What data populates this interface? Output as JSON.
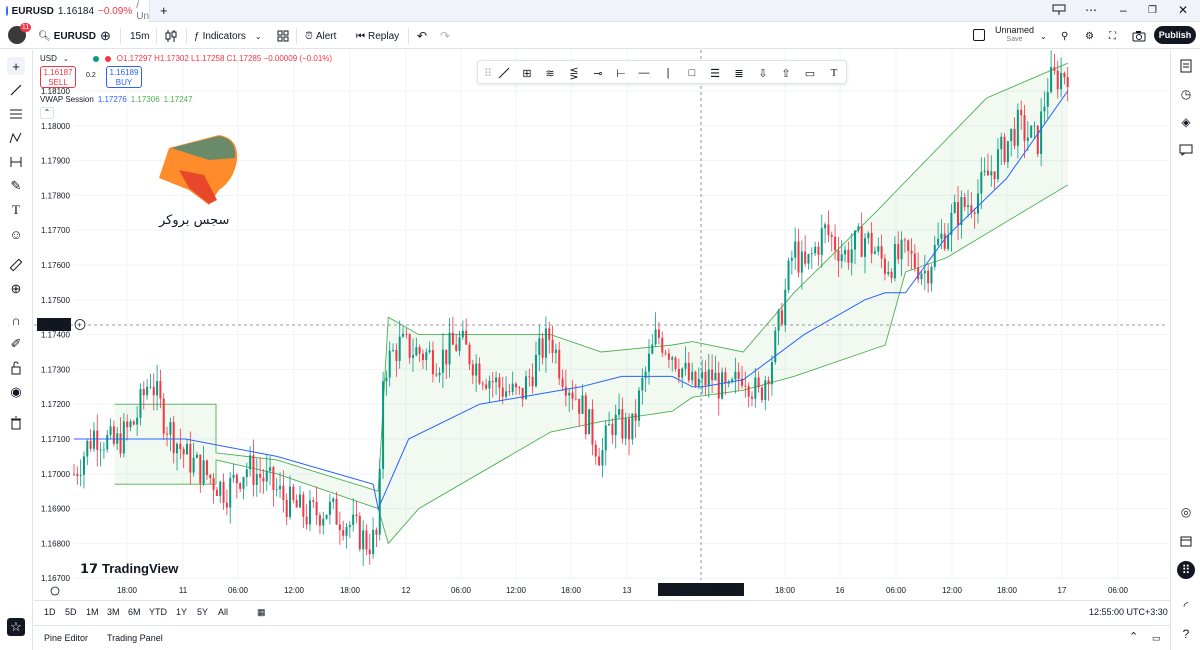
{
  "browser_tab": {
    "symbol": "EURUSD",
    "price": "1.16184",
    "change": "−0.09%",
    "suffix": "/ Un"
  },
  "header": {
    "symbol": "EURUSD",
    "interval": "15m",
    "indicators_label": "Indicators",
    "alert_label": "Alert",
    "replay_label": "Replay",
    "layout_name": "Unnamed",
    "layout_status": "Save",
    "publish_label": "Publish",
    "notif_count": "11"
  },
  "legend": {
    "currency": "USD",
    "ohlc": "O1.17297 H1.17302 L1.17258 C1.17285 −0.00009 (−0.01%)",
    "sell_price": "1.16187",
    "sell_label": "SELL",
    "spread": "0.2",
    "buy_price": "1.16189",
    "buy_label": "BUY",
    "vwap_label": "VWAP Session",
    "vwap_v1": "1.17276",
    "vwap_v2": "1.17306",
    "vwap_v3": "1.17247"
  },
  "watermark": {
    "text": "سجس بروكر",
    "tv_text": "TradingView"
  },
  "crosshair": {
    "price_label": "1.17427",
    "time_label": "Mon 15 Sep '25   09:00"
  },
  "range_buttons": [
    "1D",
    "5D",
    "1M",
    "3M",
    "6M",
    "YTD",
    "1Y",
    "5Y",
    "All"
  ],
  "clock": "12:55:00 UTC+3:30",
  "footer": {
    "pine_editor": "Pine Editor",
    "trading_panel": "Trading Panel"
  },
  "colors": {
    "up": "#089981",
    "down": "#f23645",
    "vwap": "#2962ff",
    "band": "#4caf50",
    "band_fill": "rgba(76,175,80,0.08)"
  },
  "chart_data": {
    "type": "candlestick",
    "symbol": "EURUSD",
    "y_ticks": [
      "1.18100",
      "1.18000",
      "1.17900",
      "1.17800",
      "1.17700",
      "1.17600",
      "1.17500",
      "1.17400",
      "1.17300",
      "1.17200",
      "1.17100",
      "1.17000",
      "1.16900",
      "1.16800",
      "1.16700"
    ],
    "x_ticks": [
      "18:00",
      "11",
      "06:00",
      "12:00",
      "18:00",
      "12",
      "06:00",
      "12:00",
      "18:00",
      "13",
      "18:00",
      "16",
      "06:00",
      "12:00",
      "18:00",
      "17",
      "06:00"
    ],
    "ylim": [
      1.1667,
      1.1815
    ],
    "price_path": [
      [
        0,
        1.17
      ],
      [
        0.02,
        1.1712
      ],
      [
        0.04,
        1.1708
      ],
      [
        0.06,
        1.1715
      ],
      [
        0.075,
        1.1728
      ],
      [
        0.09,
        1.1715
      ],
      [
        0.11,
        1.1705
      ],
      [
        0.13,
        1.17
      ],
      [
        0.15,
        1.1695
      ],
      [
        0.17,
        1.1702
      ],
      [
        0.19,
        1.1698
      ],
      [
        0.21,
        1.1692
      ],
      [
        0.23,
        1.1688
      ],
      [
        0.25,
        1.169
      ],
      [
        0.27,
        1.1686
      ],
      [
        0.29,
        1.168
      ],
      [
        0.3,
        1.1682
      ],
      [
        0.305,
        1.173
      ],
      [
        0.32,
        1.1737
      ],
      [
        0.34,
        1.1735
      ],
      [
        0.36,
        1.1733
      ],
      [
        0.38,
        1.1738
      ],
      [
        0.4,
        1.173
      ],
      [
        0.42,
        1.1725
      ],
      [
        0.44,
        1.1722
      ],
      [
        0.46,
        1.1735
      ],
      [
        0.47,
        1.174
      ],
      [
        0.48,
        1.173
      ],
      [
        0.5,
        1.172
      ],
      [
        0.51,
        1.1712
      ],
      [
        0.52,
        1.1705
      ],
      [
        0.53,
        1.1715
      ],
      [
        0.55,
        1.1712
      ],
      [
        0.56,
        1.1725
      ],
      [
        0.575,
        1.174
      ],
      [
        0.59,
        1.1735
      ],
      [
        0.61,
        1.1725
      ],
      [
        0.63,
        1.1728
      ],
      [
        0.645,
        1.1722
      ],
      [
        0.66,
        1.173
      ],
      [
        0.675,
        1.1722
      ],
      [
        0.69,
        1.1735
      ],
      [
        0.7,
        1.175
      ],
      [
        0.71,
        1.1765
      ],
      [
        0.72,
        1.1758
      ],
      [
        0.74,
        1.177
      ],
      [
        0.76,
        1.1763
      ],
      [
        0.78,
        1.1768
      ],
      [
        0.8,
        1.176
      ],
      [
        0.82,
        1.1763
      ],
      [
        0.84,
        1.1758
      ],
      [
        0.85,
        1.1765
      ],
      [
        0.87,
        1.1775
      ],
      [
        0.89,
        1.178
      ],
      [
        0.91,
        1.179
      ],
      [
        0.93,
        1.18
      ],
      [
        0.95,
        1.1795
      ],
      [
        0.96,
        1.1812
      ],
      [
        0.98,
        1.1816
      ]
    ],
    "vwap_path": [
      [
        0,
        1.171
      ],
      [
        0.06,
        1.171
      ],
      [
        0.11,
        1.171
      ],
      [
        0.2,
        1.1705
      ],
      [
        0.295,
        1.1697
      ],
      [
        0.3,
        1.169
      ],
      [
        0.33,
        1.171
      ],
      [
        0.4,
        1.172
      ],
      [
        0.5,
        1.1725
      ],
      [
        0.54,
        1.1728
      ],
      [
        0.59,
        1.1728
      ],
      [
        0.61,
        1.1725
      ],
      [
        0.62,
        1.1725
      ],
      [
        0.66,
        1.1727
      ],
      [
        0.72,
        1.174
      ],
      [
        0.78,
        1.175
      ],
      [
        0.8,
        1.1752
      ],
      [
        0.82,
        1.1752
      ],
      [
        0.86,
        1.1768
      ],
      [
        0.92,
        1.1785
      ],
      [
        0.98,
        1.181
      ]
    ],
    "upper_band": [
      [
        0.04,
        1.172
      ],
      [
        0.14,
        1.172
      ],
      [
        0.14,
        1.1706
      ],
      [
        0.2,
        1.1704
      ],
      [
        0.3,
        1.1695
      ],
      [
        0.31,
        1.1745
      ],
      [
        0.34,
        1.174
      ],
      [
        0.47,
        1.174
      ],
      [
        0.52,
        1.1735
      ],
      [
        0.59,
        1.1737
      ],
      [
        0.61,
        1.1738
      ],
      [
        0.66,
        1.1735
      ],
      [
        0.71,
        1.1752
      ],
      [
        0.79,
        1.1775
      ],
      [
        0.8,
        1.1778
      ],
      [
        0.9,
        1.1808
      ],
      [
        0.98,
        1.1818
      ]
    ],
    "lower_band": [
      [
        0.04,
        1.1697
      ],
      [
        0.14,
        1.1697
      ],
      [
        0.14,
        1.1704
      ],
      [
        0.2,
        1.17
      ],
      [
        0.3,
        1.169
      ],
      [
        0.31,
        1.168
      ],
      [
        0.34,
        1.169
      ],
      [
        0.47,
        1.1712
      ],
      [
        0.52,
        1.1715
      ],
      [
        0.59,
        1.1718
      ],
      [
        0.61,
        1.1722
      ],
      [
        0.66,
        1.1724
      ],
      [
        0.71,
        1.1728
      ],
      [
        0.78,
        1.1735
      ],
      [
        0.8,
        1.1737
      ],
      [
        0.82,
        1.1758
      ],
      [
        0.86,
        1.1762
      ],
      [
        0.98,
        1.1783
      ]
    ]
  }
}
